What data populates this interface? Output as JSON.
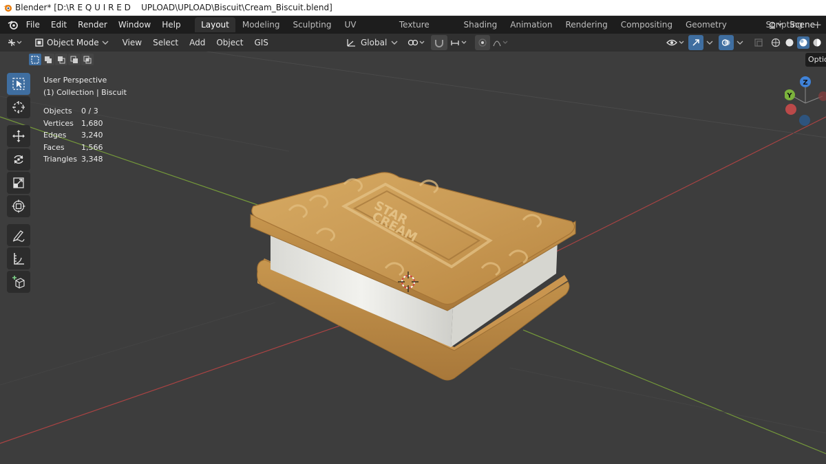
{
  "window": {
    "title": "Blender* [D:\\R E Q U I R E D    UPLOAD\\UPLOAD\\Biscuit\\Cream_Biscuit.blend]"
  },
  "menubar": {
    "items": [
      "File",
      "Edit",
      "Render",
      "Window",
      "Help"
    ],
    "workspaces": [
      {
        "label": "Layout",
        "active": true
      },
      {
        "label": "Modeling",
        "active": false
      },
      {
        "label": "Sculpting",
        "active": false
      },
      {
        "label": "UV Editing",
        "active": false
      },
      {
        "label": "Texture Paint",
        "active": false
      },
      {
        "label": "Shading",
        "active": false
      },
      {
        "label": "Animation",
        "active": false
      },
      {
        "label": "Rendering",
        "active": false
      },
      {
        "label": "Compositing",
        "active": false
      },
      {
        "label": "Geometry Nodes",
        "active": false
      },
      {
        "label": "Scripting",
        "active": false
      }
    ],
    "add_tab": "+",
    "scene": "Scene"
  },
  "header": {
    "mode": "Object Mode",
    "menus": [
      "View",
      "Select",
      "Add",
      "Object",
      "GIS"
    ],
    "transform_orientation": "Global"
  },
  "viewport": {
    "view_name": "User Perspective",
    "collection": "(1) Collection | Biscuit",
    "stats": [
      {
        "label": "Objects",
        "value": "0 / 3"
      },
      {
        "label": "Vertices",
        "value": "1,680"
      },
      {
        "label": "Edges",
        "value": "3,240"
      },
      {
        "label": "Faces",
        "value": "1,566"
      },
      {
        "label": "Triangles",
        "value": "3,348"
      }
    ],
    "options_tab": "Options",
    "biscuit_text": {
      "line1": "STAR",
      "line2": "CREAM"
    },
    "gizmo": {
      "y_label": "Y",
      "z_label": "Z"
    }
  },
  "colors": {
    "accent": "#3f6ea0",
    "biscuit": "#c99a55",
    "cream": "#e8e8e4",
    "x_axis": "#c04545",
    "y_axis": "#7ba33a"
  }
}
